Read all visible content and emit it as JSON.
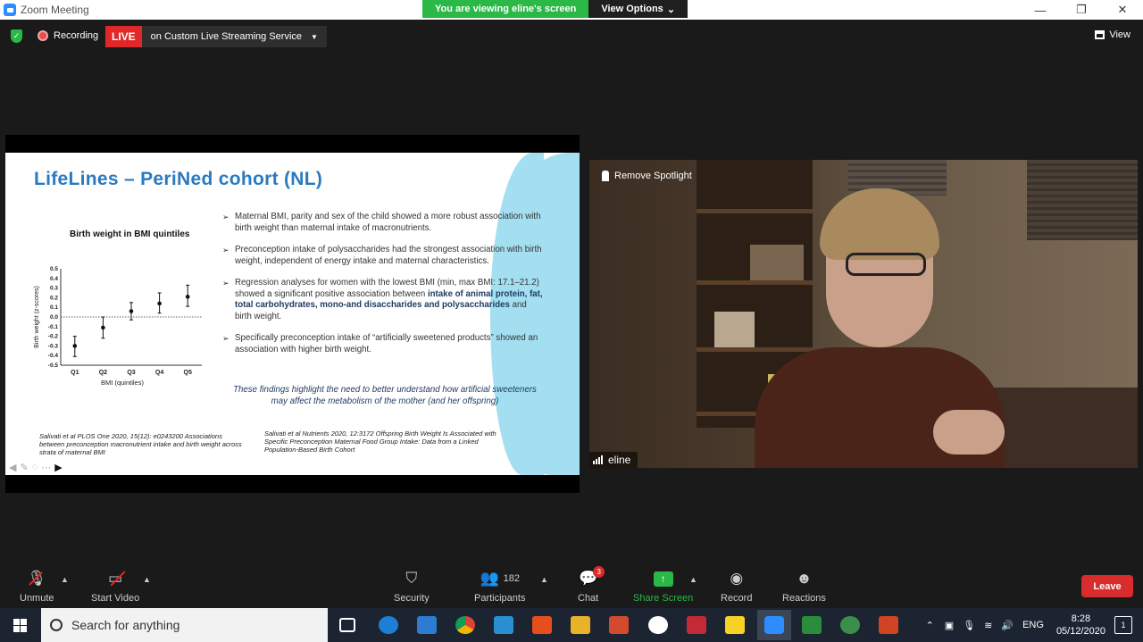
{
  "window": {
    "title": "Zoom Meeting",
    "min": "—",
    "max": "❐",
    "close": "✕"
  },
  "banner": {
    "viewing": "You are viewing eline's screen",
    "options": "View Options"
  },
  "topbar": {
    "recording": "Recording",
    "live": "LIVE",
    "live_service": "on Custom Live Streaming Service",
    "view": "View"
  },
  "slide": {
    "title": "LifeLines – PeriNed cohort (NL)",
    "chart_title": "Birth weight in BMI quintiles",
    "bullets": [
      {
        "text": "Maternal BMI, parity and sex of the child showed a more robust association with birth weight than maternal intake of macronutrients."
      },
      {
        "text": "Preconception intake of polysaccharides had the strongest association with birth weight, independent of energy intake and maternal characteristics."
      },
      {
        "pre": "Regression analyses for women with the lowest BMI (min, max BMI: 17.1–21.2) showed a significant positive association between ",
        "bold": "intake of animal protein, fat, total carbohydrates, mono-and disaccharides and polysaccharides",
        "post": " and birth weight."
      },
      {
        "text": "Specifically preconception intake of “artificially sweetened products” showed an association with higher birth weight."
      }
    ],
    "highlight": "These findings highlight the need to better understand how artificial sweeteners may affect the metabolism of the mother (and her offspring)",
    "ref1": "Salivati et al PLOS One 2020, 15(12): e0243200  Associations between preconception macronutrient intake and birth weight across strata of maternal BMI",
    "ref2": "Salivati et al Nutrients 2020, 12:3172 Offspring Birth Weight Is Associated with Specific Preconception Maternal Food Group Intake: Data from a Linked Population-Based Birth Cohort"
  },
  "chart_data": {
    "type": "scatter",
    "title": "Birth weight in BMI quintiles",
    "xlabel": "BMI (quintiles)",
    "ylabel": "Birth weight (z-scores)",
    "categories": [
      "Q1",
      "Q2",
      "Q3",
      "Q4",
      "Q5"
    ],
    "values": [
      -0.3,
      -0.11,
      0.06,
      0.14,
      0.21
    ],
    "err_low": [
      -0.41,
      -0.22,
      -0.03,
      0.04,
      0.11
    ],
    "err_high": [
      -0.2,
      0.0,
      0.15,
      0.25,
      0.33
    ],
    "ylim": [
      -0.5,
      0.5
    ],
    "yticks": [
      "0.5",
      "0.4",
      "0.3",
      "0.2",
      "0.1",
      "0.0",
      "-0.1",
      "-0.2",
      "-0.3",
      "-0.4",
      "-0.5"
    ],
    "reference_line": 0.0
  },
  "video": {
    "spotlight": "Remove Spotlight",
    "name": "eline"
  },
  "toolbar": {
    "unmute": "Unmute",
    "start_video": "Start Video",
    "security": "Security",
    "participants": "Participants",
    "participants_count": "182",
    "chat": "Chat",
    "chat_badge": "3",
    "share": "Share Screen",
    "record": "Record",
    "reactions": "Reactions",
    "leave": "Leave"
  },
  "taskbar": {
    "search": "Search for anything",
    "lang": "ENG",
    "time": "8:28",
    "date": "05/12/2020",
    "notif": "1"
  }
}
